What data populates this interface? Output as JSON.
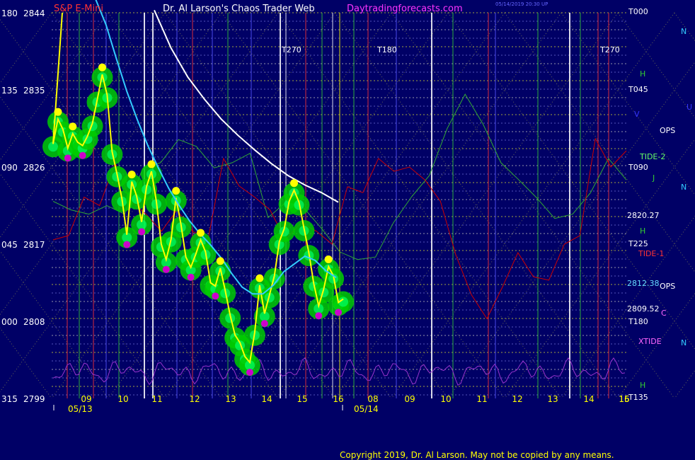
{
  "header": {
    "symbol": "S&P E-Mini",
    "title": "Dr. Al Larson's Chaos Trader Web",
    "site": "Daytradingforecasts.com",
    "stamp": "05/14/2019 20:30 UP"
  },
  "footer": {
    "copyright": "Copyright 2019, Dr. Al Larson. May not be copied by any means."
  },
  "colors": {
    "background": "#000066",
    "price_area": "#00cc00",
    "price_line": "#ffff00",
    "average_line": "#33ccff",
    "decline_line": "#ffffff",
    "high_marker": "#ffff00",
    "low_marker": "#cc00cc",
    "tide1": "#cc0000",
    "tide2": "#33aa33",
    "xtide": "#9933cc"
  },
  "chart_data": {
    "type": "line",
    "title": "S&P E-Mini",
    "y_axis": {
      "range": [
        2799,
        2844
      ],
      "ticks": [
        {
          "angle": "180",
          "price": "2844"
        },
        {
          "angle": "135",
          "price": "2835"
        },
        {
          "angle": "090",
          "price": "2826"
        },
        {
          "angle": "045",
          "price": "2817"
        },
        {
          "angle": "000",
          "price": "2808"
        },
        {
          "angle": "315",
          "price": "2799"
        }
      ]
    },
    "x_axis": {
      "ticks": [
        "09",
        "10",
        "11",
        "12",
        "13",
        "14",
        "15",
        "16",
        "08",
        "09",
        "10",
        "11",
        "12",
        "13",
        "14",
        "15",
        "16"
      ],
      "dates": [
        "05/13",
        "05/14"
      ]
    },
    "series": [
      {
        "name": "S&P E-Mini",
        "values": [
          2828.7,
          2831.6,
          2830.4,
          2828.2,
          2829.9,
          2828.9,
          2828.5,
          2829.6,
          2831.1,
          2833.9,
          2836.8,
          2834.4,
          2827.8,
          2825.2,
          2822.3,
          2818.1,
          2824.3,
          2822.6,
          2819.6,
          2823.7,
          2825.5,
          2822.0,
          2817.0,
          2815.2,
          2817.6,
          2822.4,
          2819.3,
          2815.5,
          2814.3,
          2815.8,
          2817.5,
          2816.1,
          2812.5,
          2812.1,
          2814.2,
          2811.6,
          2808.7,
          2806.4,
          2805.5,
          2803.9,
          2803.2,
          2806.7,
          2812.2,
          2808.9,
          2811.1,
          2813.3,
          2817.3,
          2818.8,
          2822.0,
          2823.3,
          2821.9,
          2818.9,
          2816.0,
          2812.4,
          2809.8,
          2811.7,
          2814.4,
          2813.3,
          2810.2,
          2810.6
        ]
      },
      {
        "name": "average",
        "values": [
          2845.6,
          2842.6,
          2838.6,
          2834.8,
          2831.5,
          2828.5,
          2825.9,
          2823.5,
          2821.5,
          2819.7,
          2818.2,
          2816.9,
          2815.4,
          2813.6,
          2812.0,
          2811.2,
          2811.2,
          2812.2,
          2813.8,
          2814.7,
          2815.6,
          2815.1,
          2813.9,
          2813.1
        ]
      },
      {
        "name": "decline",
        "values": [
          2844.3,
          2839.9,
          2836.5,
          2833.9,
          2831.6,
          2829.7,
          2828.0,
          2826.4,
          2825.0,
          2823.9,
          2823.0,
          2821.9
        ]
      },
      {
        "name": "+TIDE-2",
        "values": [
          2822.0,
          2821.0,
          2820.5,
          2821.5,
          2820.5,
          2825.8,
          2826.5,
          2829.2,
          2828.4,
          2825.9,
          2826.5,
          2827.6,
          2820.1,
          2821.9,
          2821.2,
          2818.8,
          2816.1,
          2815.2,
          2815.5,
          2819.5,
          2822.5,
          2825.0,
          2830.5,
          2834.5,
          2831.0,
          2826.5,
          2824.5,
          2822.4,
          2820.0,
          2820.5,
          2823.0,
          2827.0,
          2824.5
        ]
      },
      {
        "name": "-TIDE-1",
        "values": [
          2817.5,
          2818.0,
          2822.5,
          2821.5,
          2826.5,
          2822.0,
          2820.5,
          2818.5,
          2821.0,
          2818.5,
          2817.5,
          2827.0,
          2823.8,
          2822.5,
          2821.0,
          2817.5,
          2819.5,
          2818.5,
          2817.0,
          2823.7,
          2823.0,
          2827.0,
          2825.5,
          2826.0,
          2824.5,
          2822.0,
          2815.7,
          2811.1,
          2808.3,
          2812.0,
          2816.0,
          2813.2,
          2812.8,
          2817.0,
          2818.0,
          2829.3,
          2826.0,
          2827.9
        ]
      }
    ],
    "labels": {
      "right": [
        "T000",
        "T045",
        "T090",
        "T225",
        "T180",
        "T135",
        "TIDE-2",
        "TIDE-1",
        "XTIDE",
        "2820.27",
        "2812.38",
        "2809.52",
        "C",
        "J",
        "H",
        "N",
        "U",
        "V",
        "OPS"
      ],
      "times": [
        "T270",
        "T180",
        "T270"
      ]
    }
  }
}
